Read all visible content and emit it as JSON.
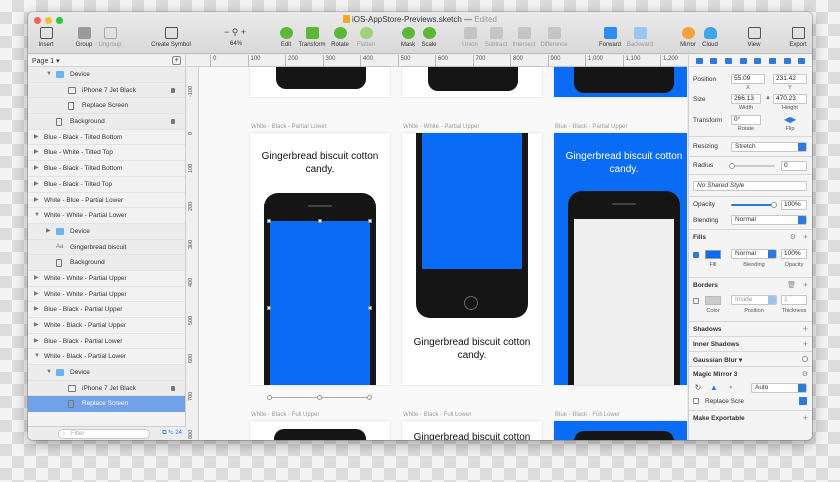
{
  "window": {
    "doc_name": "iOS-AppStore-Previews.sketch",
    "doc_status": "Edited"
  },
  "toolbar": {
    "insert": "Insert",
    "group": "Group",
    "ungroup": "Ungroup",
    "create_symbol": "Create Symbol",
    "zoom_value": "64%",
    "edit": "Edit",
    "transform": "Transform",
    "rotate": "Rotate",
    "flatten": "Flatten",
    "mask": "Mask",
    "scale": "Scale",
    "union": "Union",
    "subtract": "Subtract",
    "intersect": "Intersect",
    "difference": "Difference",
    "forward": "Forward",
    "backward": "Backward",
    "mirror": "Mirror",
    "cloud": "Cloud",
    "view": "View",
    "export": "Export"
  },
  "sidebar": {
    "page": "Page 1",
    "layers": [
      {
        "name": "Device",
        "icon": "folder-icon",
        "indent": 1,
        "expanded": true
      },
      {
        "name": "iPhone 7 Jet Black",
        "icon": "image-icon",
        "indent": 2,
        "locked": true
      },
      {
        "name": "Replace Screen",
        "icon": "rectangle-icon",
        "indent": 2
      },
      {
        "name": "Background",
        "icon": "rectangle-icon",
        "indent": 1,
        "locked": true
      },
      {
        "name": "Blue - Black - Tilted Bottom",
        "indent": 0
      },
      {
        "name": "Blue - White - Tilted Top",
        "indent": 0
      },
      {
        "name": "Blue - Black - Tilted Bottom",
        "indent": 0
      },
      {
        "name": "Blue - Black - Tilted Top",
        "indent": 0
      },
      {
        "name": "White - Blue - Partial Lower",
        "indent": 0
      },
      {
        "name": "White - White - Partial Lower",
        "indent": 0,
        "expanded": true
      },
      {
        "name": "Device",
        "icon": "folder-icon",
        "indent": 1
      },
      {
        "name": "Gingerbread biscuit",
        "icon": "text-icon",
        "indent": 1
      },
      {
        "name": "Background",
        "icon": "rectangle-icon",
        "indent": 1
      },
      {
        "name": "White - White - Partial Upper",
        "indent": 0
      },
      {
        "name": "White - White - Partial Upper",
        "indent": 0
      },
      {
        "name": "Blue - Black - Partial Upper",
        "indent": 0
      },
      {
        "name": "White - Black - Partial Upper",
        "indent": 0
      },
      {
        "name": "Blue - Black - Partial Lower",
        "indent": 0
      },
      {
        "name": "White - Black - Partial Lower",
        "indent": 0,
        "expanded": true
      },
      {
        "name": "Device",
        "icon": "folder-icon",
        "indent": 1,
        "expanded": true
      },
      {
        "name": "iPhone 7 Jet Black",
        "icon": "image-icon",
        "indent": 2,
        "locked": true
      },
      {
        "name": "Replace Screen",
        "icon": "rectangle-icon",
        "indent": 2,
        "selected": true
      }
    ],
    "filter_placeholder": "Filter",
    "filter_count": "24"
  },
  "canvas": {
    "ruler_h": [
      "0",
      "100",
      "200",
      "300",
      "400",
      "500",
      "600",
      "700",
      "800",
      "900",
      "1,000",
      "1,100",
      "1,200"
    ],
    "ruler_v": [
      "-100",
      "0",
      "100",
      "200",
      "300",
      "400",
      "500",
      "600",
      "700",
      "800"
    ],
    "artboards": [
      {
        "label": "White - Black - Partial Lower",
        "headline": "Gingerbread biscuit cotton candy."
      },
      {
        "label": "White - White - Partial Upper",
        "headline": "Gingerbread biscuit cotton candy."
      },
      {
        "label": "Blue - Black - Partial Upper",
        "headline": "Gingerbread biscuit cotton candy."
      },
      {
        "label": "White - Black - Full Upper"
      },
      {
        "label": "White - Black - Full Lower",
        "headline": "Gingerbread biscuit cotton candy."
      },
      {
        "label": "Blue - Black - Full Lower"
      }
    ],
    "colors": {
      "blue": "#0a6cf5",
      "phone": "#151515"
    }
  },
  "inspector": {
    "position_label": "Position",
    "x": "55.09",
    "x_label": "X",
    "y": "231.42",
    "y_label": "Y",
    "size_label": "Size",
    "width": "266.13",
    "width_label": "Width",
    "height": "470.23",
    "height_label": "Height",
    "transform_label": "Transform",
    "rotate": "0°",
    "rotate_label": "Rotate",
    "flip_label": "Flip",
    "resizing_label": "Resizing",
    "resizing_value": "Stretch",
    "radius_label": "Radius",
    "radius_value": "0",
    "shared_style": "No Shared Style",
    "opacity_label": "Opacity",
    "opacity_value": "100%",
    "blending_label": "Blending",
    "blending_value": "Normal",
    "fills_label": "Fills",
    "fill_blend": "Normal",
    "fill_opacity": "100%",
    "fill_label": "Fill",
    "fill_blend_label": "Blending",
    "fill_opacity_label": "Opacity",
    "fill_color": "#0a6cf5",
    "borders_label": "Borders",
    "border_position": "Inside",
    "border_thickness": "1",
    "border_color_label": "Color",
    "border_position_label": "Position",
    "border_thickness_label": "Thickness",
    "shadows_label": "Shadows",
    "inner_shadows_label": "Inner Shadows",
    "gaussian_label": "Gaussian Blur",
    "mirror_label": "Magic Mirror 3",
    "mirror_mode": "Auto",
    "replace_label": "Replace Scre",
    "exportable_label": "Make Exportable"
  }
}
